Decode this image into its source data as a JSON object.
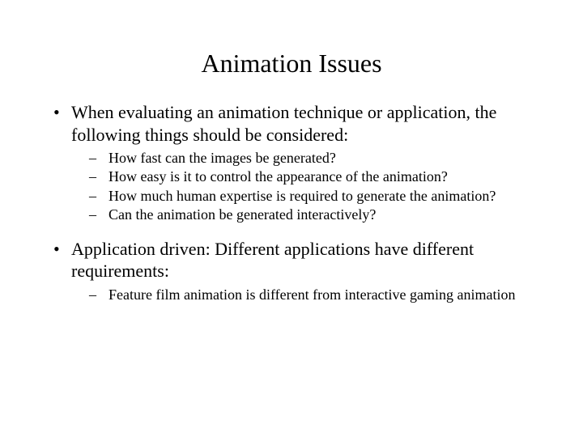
{
  "title": "Animation Issues",
  "bullets": {
    "b1": "When evaluating an animation technique or application, the following things should be considered:",
    "b1_subs": {
      "s1": "How fast can the images be generated?",
      "s2": "How easy is it to control the appearance of the animation?",
      "s3": "How much human expertise is required to generate the animation?",
      "s4": "Can the animation be generated interactively?"
    },
    "b2": "Application driven: Different applications have different requirements:",
    "b2_subs": {
      "s1": "Feature film animation is different from interactive gaming animation"
    }
  }
}
